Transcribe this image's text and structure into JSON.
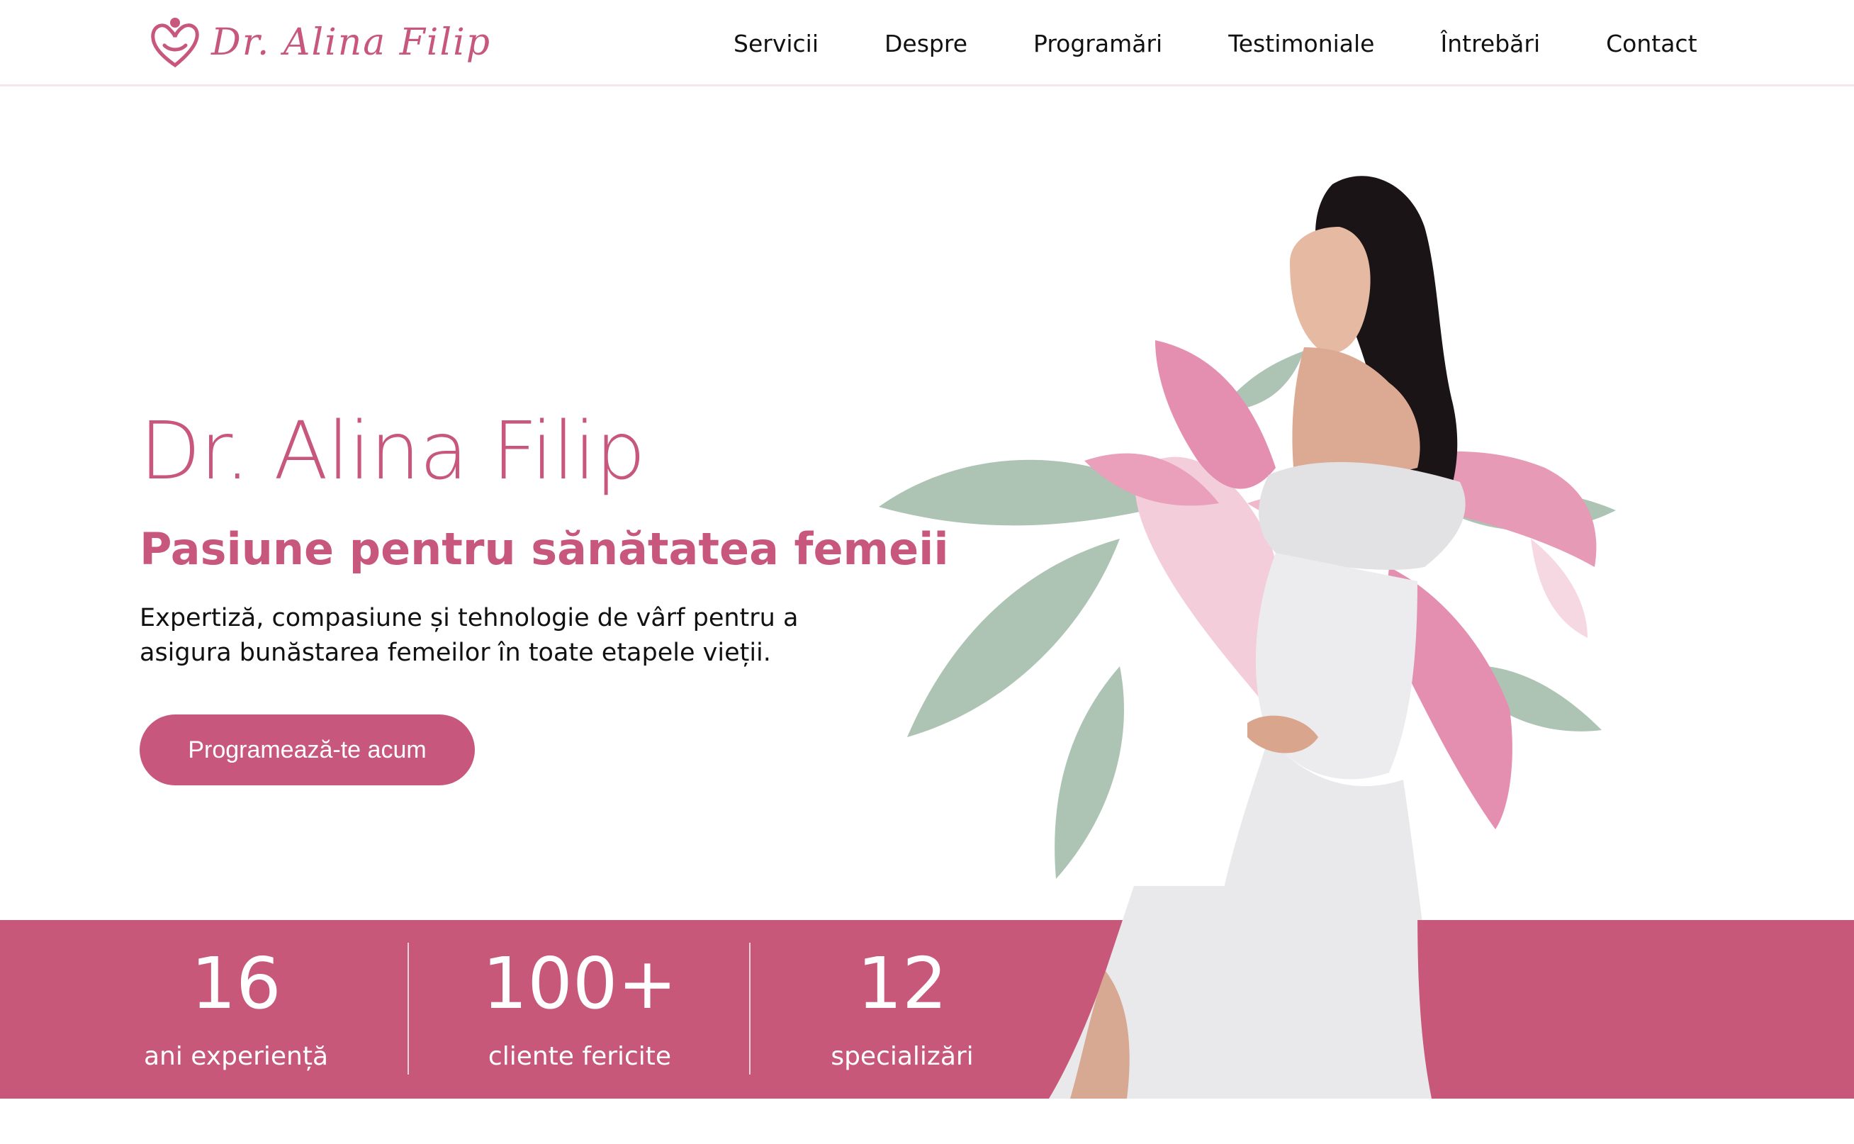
{
  "header": {
    "logo_text": "Dr. Alina Filip",
    "nav": [
      "Servicii",
      "Despre",
      "Programări",
      "Testimoniale",
      "Întrebări",
      "Contact"
    ]
  },
  "hero": {
    "title": "Dr. Alina Filip",
    "subtitle_bold": "Pasiune",
    "subtitle_rest": " pentru sănătatea femeii",
    "description": "Expertiză, compasiune și tehnologie de vârf pentru a asigura bunăstarea femeilor în toate etapele vieții.",
    "cta_label": "Programează-te acum"
  },
  "stats": [
    {
      "value": "16",
      "label": "ani experiență"
    },
    {
      "value": "100+",
      "label": "cliente fericite"
    },
    {
      "value": "12",
      "label": "specializări"
    }
  ],
  "colors": {
    "brand": "#c8577d",
    "band": "#c8587a",
    "petal": "#e79ab5",
    "leaf": "#a9c1b1"
  },
  "illustration": "pregnant-woman-with-lily-photo"
}
